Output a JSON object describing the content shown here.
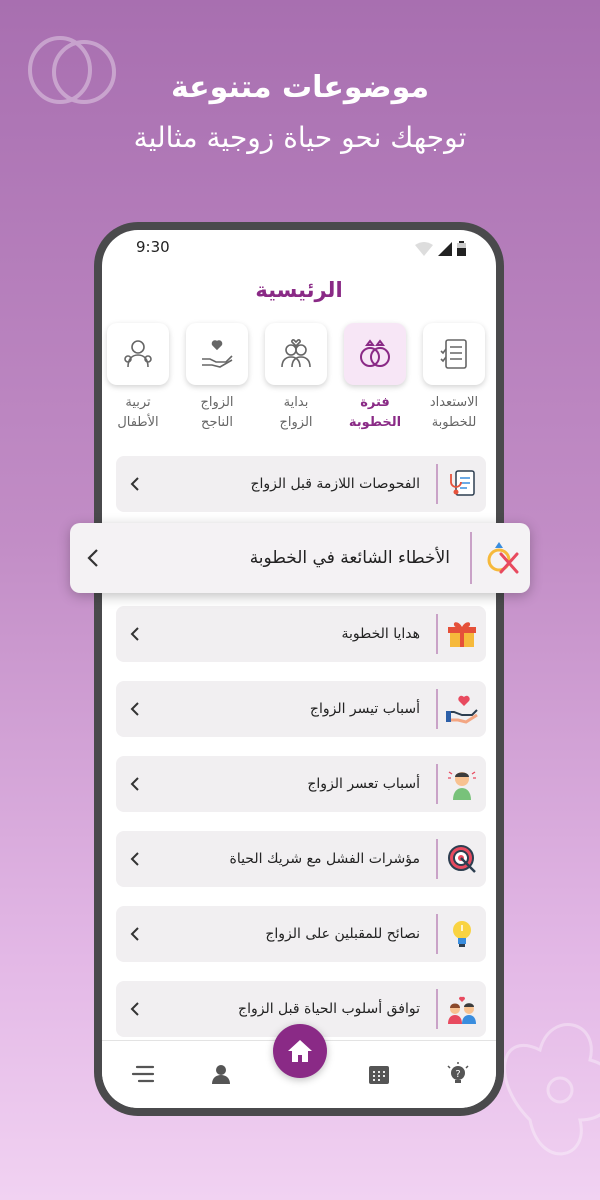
{
  "promo": {
    "headline": "موضوعات متنوعة",
    "subheadline": "توجهك نحو حياة زوجية مثالية"
  },
  "status_bar": {
    "time": "9:30"
  },
  "app": {
    "title": "الرئيسية"
  },
  "categories": [
    {
      "line1": "الاستعداد",
      "line2": "للخطوبة",
      "icon": "checklist-icon",
      "active": false
    },
    {
      "line1": "فترة",
      "line2": "الخطوبة",
      "icon": "rings-icon",
      "active": true
    },
    {
      "line1": "بداية",
      "line2": "الزواج",
      "icon": "couple-icon",
      "active": false
    },
    {
      "line1": "الزواج",
      "line2": "الناجح",
      "icon": "heart-hands-icon",
      "active": false
    },
    {
      "line1": "تربية",
      "line2": "الأطفال",
      "icon": "family-icon",
      "active": false
    }
  ],
  "topics": [
    {
      "label": "الفحوصات اللازمة قبل الزواج",
      "icon": "medical-check-icon"
    },
    {
      "label": "هدايا الخطوبة",
      "icon": "gift-icon"
    },
    {
      "label": "أسباب تيسر الزواج",
      "icon": "heart-hand-icon"
    },
    {
      "label": "أسباب تعسر الزواج",
      "icon": "worried-person-icon"
    },
    {
      "label": "مؤشرات الفشل مع شريك الحياة",
      "icon": "broken-target-icon"
    },
    {
      "label": "نصائح للمقبلين على الزواج",
      "icon": "lightbulb-icon"
    },
    {
      "label": "توافق أسلوب الحياة قبل الزواج",
      "icon": "couple-heart-icon"
    }
  ],
  "featured_topic": {
    "label": "الأخطاء الشائعة في الخطوبة",
    "icon": "ring-cross-icon"
  },
  "bottom_nav": [
    "menu-icon",
    "profile-icon",
    "home-icon",
    "calendar-icon",
    "tips-icon"
  ],
  "colors": {
    "accent": "#8a2a86",
    "card": "#f1eff1",
    "separator": "#c9a2c7"
  }
}
